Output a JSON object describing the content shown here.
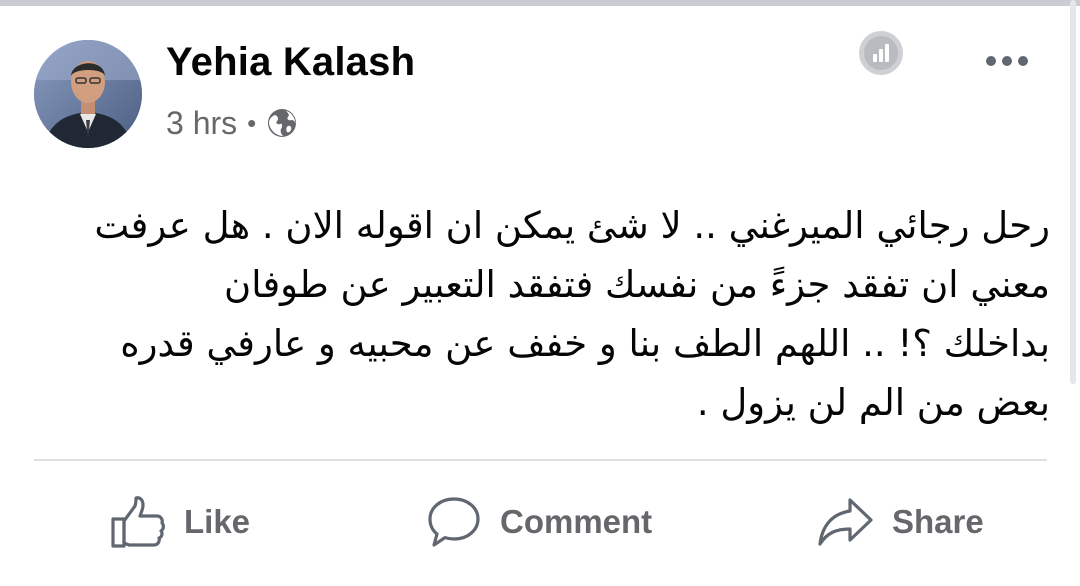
{
  "post": {
    "author": "Yehia Kalash",
    "time": "3 hrs",
    "separator": "•",
    "audience_icon": "globe-icon",
    "text_lines": [
      "رحل رجائي الميرغني .. لا شئ يمكن ان اقوله الان . هل عرفت",
      "معني ان تفقد جزءً من نفسك فتفقد التعبير عن طوفان",
      "بداخلك ؟! .. اللهم الطف بنا و خفف عن محبيه و عارفي قدره",
      "بعض من الم لن يزول ."
    ]
  },
  "header_icons": {
    "insights": "insights-icon",
    "more": "more-options-icon"
  },
  "actions": {
    "like_label": "Like",
    "comment_label": "Comment",
    "share_label": "Share"
  },
  "colors": {
    "text_primary": "#050505",
    "text_secondary": "#65676b",
    "icon_gray": "#606770",
    "divider": "#dddfe2"
  }
}
